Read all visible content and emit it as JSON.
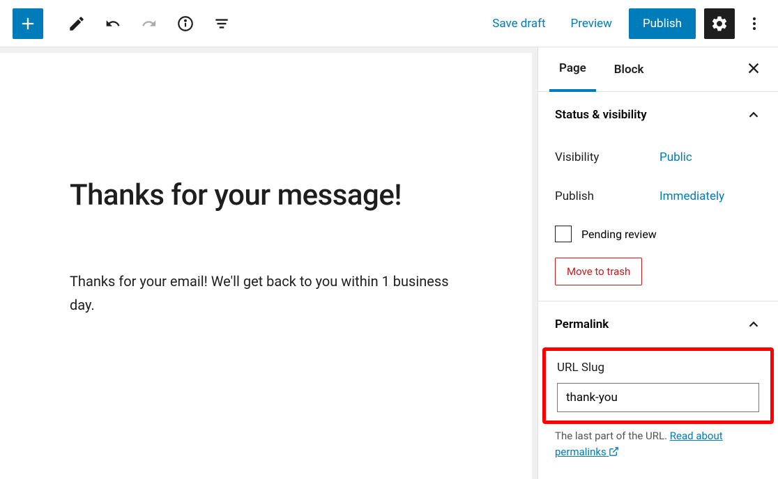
{
  "toolbar": {
    "save_draft": "Save draft",
    "preview": "Preview",
    "publish": "Publish"
  },
  "editor": {
    "title": "Thanks for your message!",
    "body": "Thanks for your email! We'll get back to you within 1 business day."
  },
  "sidebar": {
    "tabs": {
      "page": "Page",
      "block": "Block"
    },
    "status": {
      "heading": "Status & visibility",
      "visibility_label": "Visibility",
      "visibility_value": "Public",
      "publish_label": "Publish",
      "publish_value": "Immediately",
      "pending_review": "Pending review",
      "move_to_trash": "Move to trash"
    },
    "permalink": {
      "heading": "Permalink",
      "slug_label": "URL Slug",
      "slug_value": "thank-you",
      "help_text_prefix": "The last part of the URL. ",
      "help_link": "Read about permalinks"
    }
  }
}
